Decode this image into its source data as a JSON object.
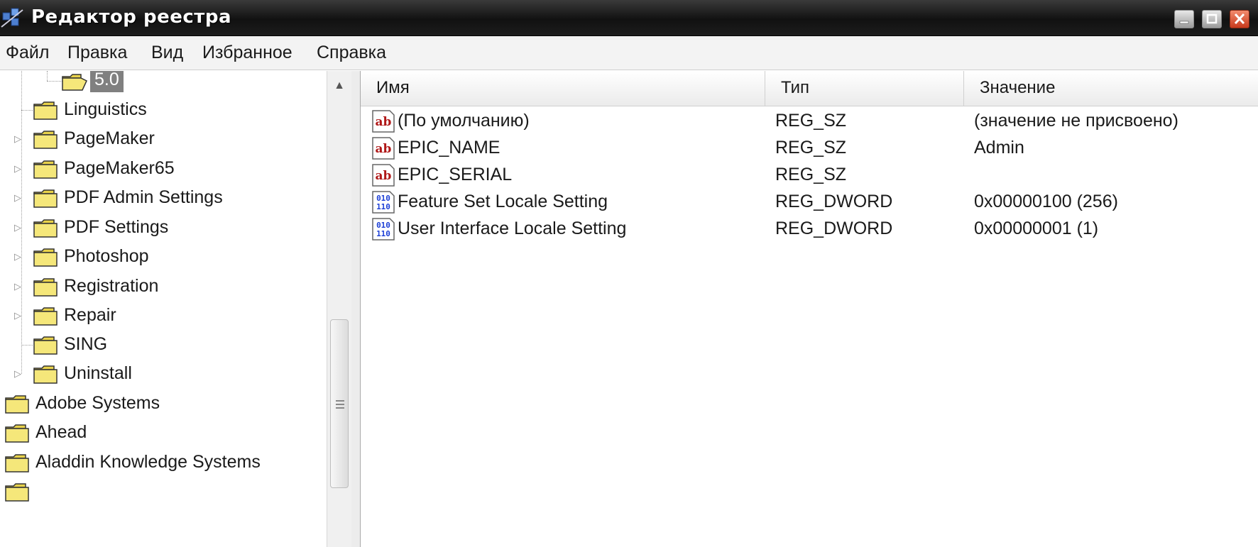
{
  "window": {
    "title": "Редактор реестра"
  },
  "menu": [
    "Файл",
    "Правка",
    "Вид",
    "Избранное",
    "Справка"
  ],
  "tree": {
    "items": [
      {
        "label": "5.0",
        "selected": true,
        "has_children": false
      },
      {
        "label": "Linguistics",
        "has_children": false
      },
      {
        "label": "PageMaker",
        "has_children": true
      },
      {
        "label": "PageMaker65",
        "has_children": true
      },
      {
        "label": "PDF Admin Settings",
        "has_children": true
      },
      {
        "label": "PDF Settings",
        "has_children": true
      },
      {
        "label": "Photoshop",
        "has_children": true
      },
      {
        "label": "Registration",
        "has_children": true
      },
      {
        "label": "Repair",
        "has_children": true
      },
      {
        "label": "SING",
        "has_children": false
      },
      {
        "label": "Uninstall",
        "has_children": true
      },
      {
        "label": "Adobe Systems"
      },
      {
        "label": "Ahead"
      },
      {
        "label": "Aladdin Knowledge Systems"
      }
    ]
  },
  "values": {
    "columns": [
      "Имя",
      "Тип",
      "Значение"
    ],
    "rows": [
      {
        "icon": "string-value-icon",
        "name": "(По умолчанию)",
        "type": "REG_SZ",
        "value": "(значение не присвоено)"
      },
      {
        "icon": "string-value-icon",
        "name": "EPIC_NAME",
        "type": "REG_SZ",
        "value": "Admin"
      },
      {
        "icon": "string-value-icon",
        "name": "EPIC_SERIAL",
        "type": "REG_SZ",
        "value": ""
      },
      {
        "icon": "binary-value-icon",
        "name": "Feature Set Locale Setting",
        "type": "REG_DWORD",
        "value": "0x00000100 (256)"
      },
      {
        "icon": "binary-value-icon",
        "name": "User Interface Locale Setting",
        "type": "REG_DWORD",
        "value": "0x00000001 (1)"
      }
    ]
  },
  "colors": {
    "selection": "#808080",
    "folder": "#f5e77a",
    "string_icon": "#b01818",
    "binary_icon": "#1c3fd6"
  }
}
